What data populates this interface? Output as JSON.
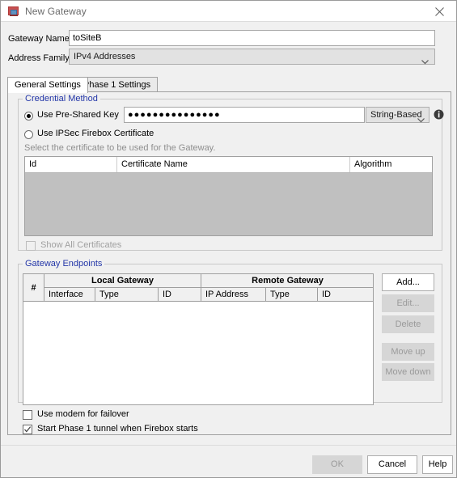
{
  "window": {
    "title": "New Gateway",
    "icon": "gateway-icon",
    "close_label": "Close"
  },
  "form": {
    "gateway_name_label": "Gateway Name:",
    "gateway_name_value": "toSiteB",
    "address_family_label": "Address Family:",
    "address_family_value": "IPv4 Addresses"
  },
  "tabs": [
    {
      "label": "General Settings",
      "active": true
    },
    {
      "label": "Phase 1 Settings",
      "active": false
    }
  ],
  "credential_method": {
    "group_title": "Credential Method",
    "psk_radio_label": "Use Pre-Shared Key",
    "psk_value": "●●●●●●●●●●●●●●●",
    "psk_format_value": "String-Based",
    "info_icon": "info-icon",
    "cert_radio_label": "Use IPSec Firebox Certificate",
    "helper_text": "Select the certificate to be used for the Gateway.",
    "cert_table": {
      "columns": [
        "Id",
        "Certificate Name",
        "Algorithm"
      ],
      "rows": []
    },
    "show_all_label": "Show All Certificates",
    "show_all_checked": false
  },
  "gateway_endpoints": {
    "group_title": "Gateway Endpoints",
    "col_number": "#",
    "group_local": "Local Gateway",
    "group_remote": "Remote Gateway",
    "sub_columns": [
      "Interface",
      "Type",
      "ID",
      "IP Address",
      "Type",
      "ID"
    ],
    "rows": [],
    "buttons": [
      {
        "label": "Add...",
        "enabled": true
      },
      {
        "label": "Edit...",
        "enabled": false
      },
      {
        "label": "Delete",
        "enabled": false
      },
      {
        "label": "Move up",
        "enabled": false
      },
      {
        "label": "Move down",
        "enabled": false
      }
    ]
  },
  "options": [
    {
      "label": "Use modem for failover",
      "checked": false
    },
    {
      "label": "Start Phase 1 tunnel when Firebox starts",
      "checked": true
    }
  ],
  "footer": {
    "ok": "OK",
    "cancel": "Cancel",
    "help": "Help",
    "ok_enabled": false
  },
  "colors": {
    "group_title": "#2437a8",
    "dialog_bg": "#f0f0f0",
    "disabled_text": "#a0a0a0"
  }
}
